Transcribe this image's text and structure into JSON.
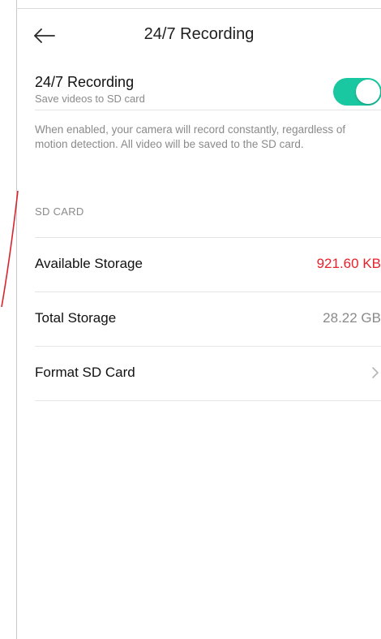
{
  "header": {
    "title": "24/7 Recording",
    "back_icon": "arrow-left-icon"
  },
  "recording": {
    "title": "24/7 Recording",
    "subtitle": "Save videos to SD card",
    "enabled": true,
    "toggle_color": "#19c7a0",
    "description": "When enabled, your camera will record constantly, regardless of motion detection. All video will be saved to the SD card."
  },
  "sd_card": {
    "section_label": "SD CARD",
    "rows": [
      {
        "label": "Available Storage",
        "value": "921.60 KB",
        "value_color": "#e8212c"
      },
      {
        "label": "Total Storage",
        "value": "28.22 GB",
        "value_color": "#8a8a8a"
      },
      {
        "label": "Format SD Card",
        "chevron_icon": "chevron-right-icon"
      }
    ]
  }
}
